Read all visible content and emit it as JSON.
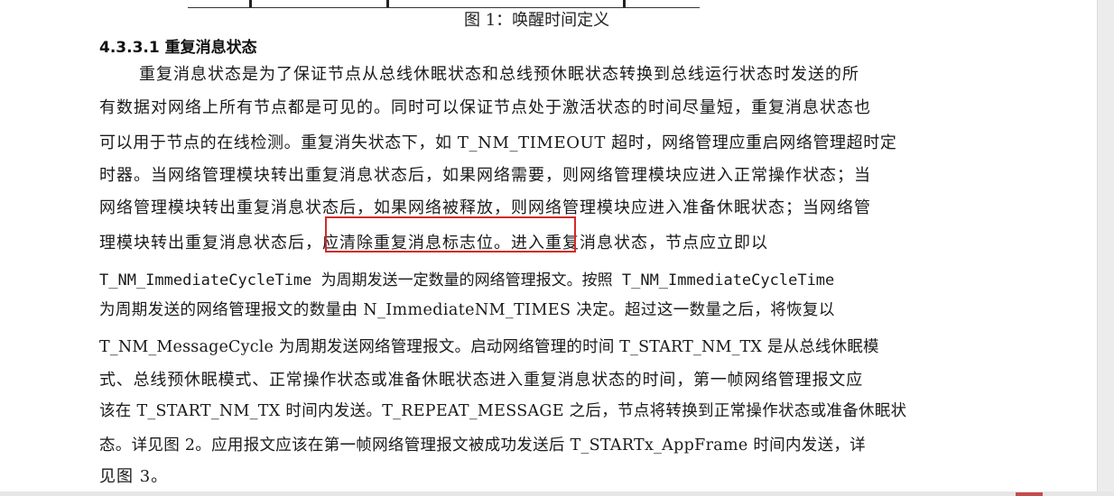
{
  "figure": {
    "caption": "图 1：唤醒时间定义"
  },
  "section": {
    "heading": "4.3.3.1 重复消息状态"
  },
  "paragraph": {
    "lines": [
      "重复消息状态是为了保证节点从总线休眠状态和总线预休眠状态转换到总线运行状态时发送的所",
      "有数据对网络上所有节点都是可见的。同时可以保证节点处于激活状态的时间尽量短，重复消息状态也",
      "可以用于节点的在线检测。重复消失状态下，如 T_NM_TIMEOUT 超时，网络管理应重启网络管理超时定",
      "时器。当网络管理模块转出重复消息状态后，如果网络需要，则网络管理模块应进入正常操作状态；当",
      "网络管理模块转出重复消息状态后，如果网络被释放，则网络管理模块应进入准备休眠状态；当网络管",
      "理模块转出重复消息状态后，应清除重复消息标志位。进入重复消息状态，节点应立即以",
      "T_NM_ImmediateCycleTime 为周期发送一定数量的网络管理报文。按照 T_NM_ImmediateCycleTime",
      "为周期发送的网络管理报文的数量由 N_ImmediateNM_TIMES 决定。超过这一数量之后，将恢复以",
      "T_NM_MessageCycle 为周期发送网络管理报文。启动网络管理的时间 T_START_NM_TX 是从总线休眠模",
      "式、总线预休眠模式、正常操作状态或准备休眠状态进入重复消息状态的时间，第一帧网络管理报文应",
      "该在 T_START_NM_TX 时间内发送。T_REPEAT_MESSAGE 之后，节点将转换到正常操作状态或准备休眠状",
      "态。详见图 2。应用报文应该在第一帧网络管理报文被成功发送后 T_STARTx_AppFrame 时间内发送，详",
      "见图 3。"
    ]
  },
  "annotation": {
    "highlight_color": "#d42a2a"
  }
}
